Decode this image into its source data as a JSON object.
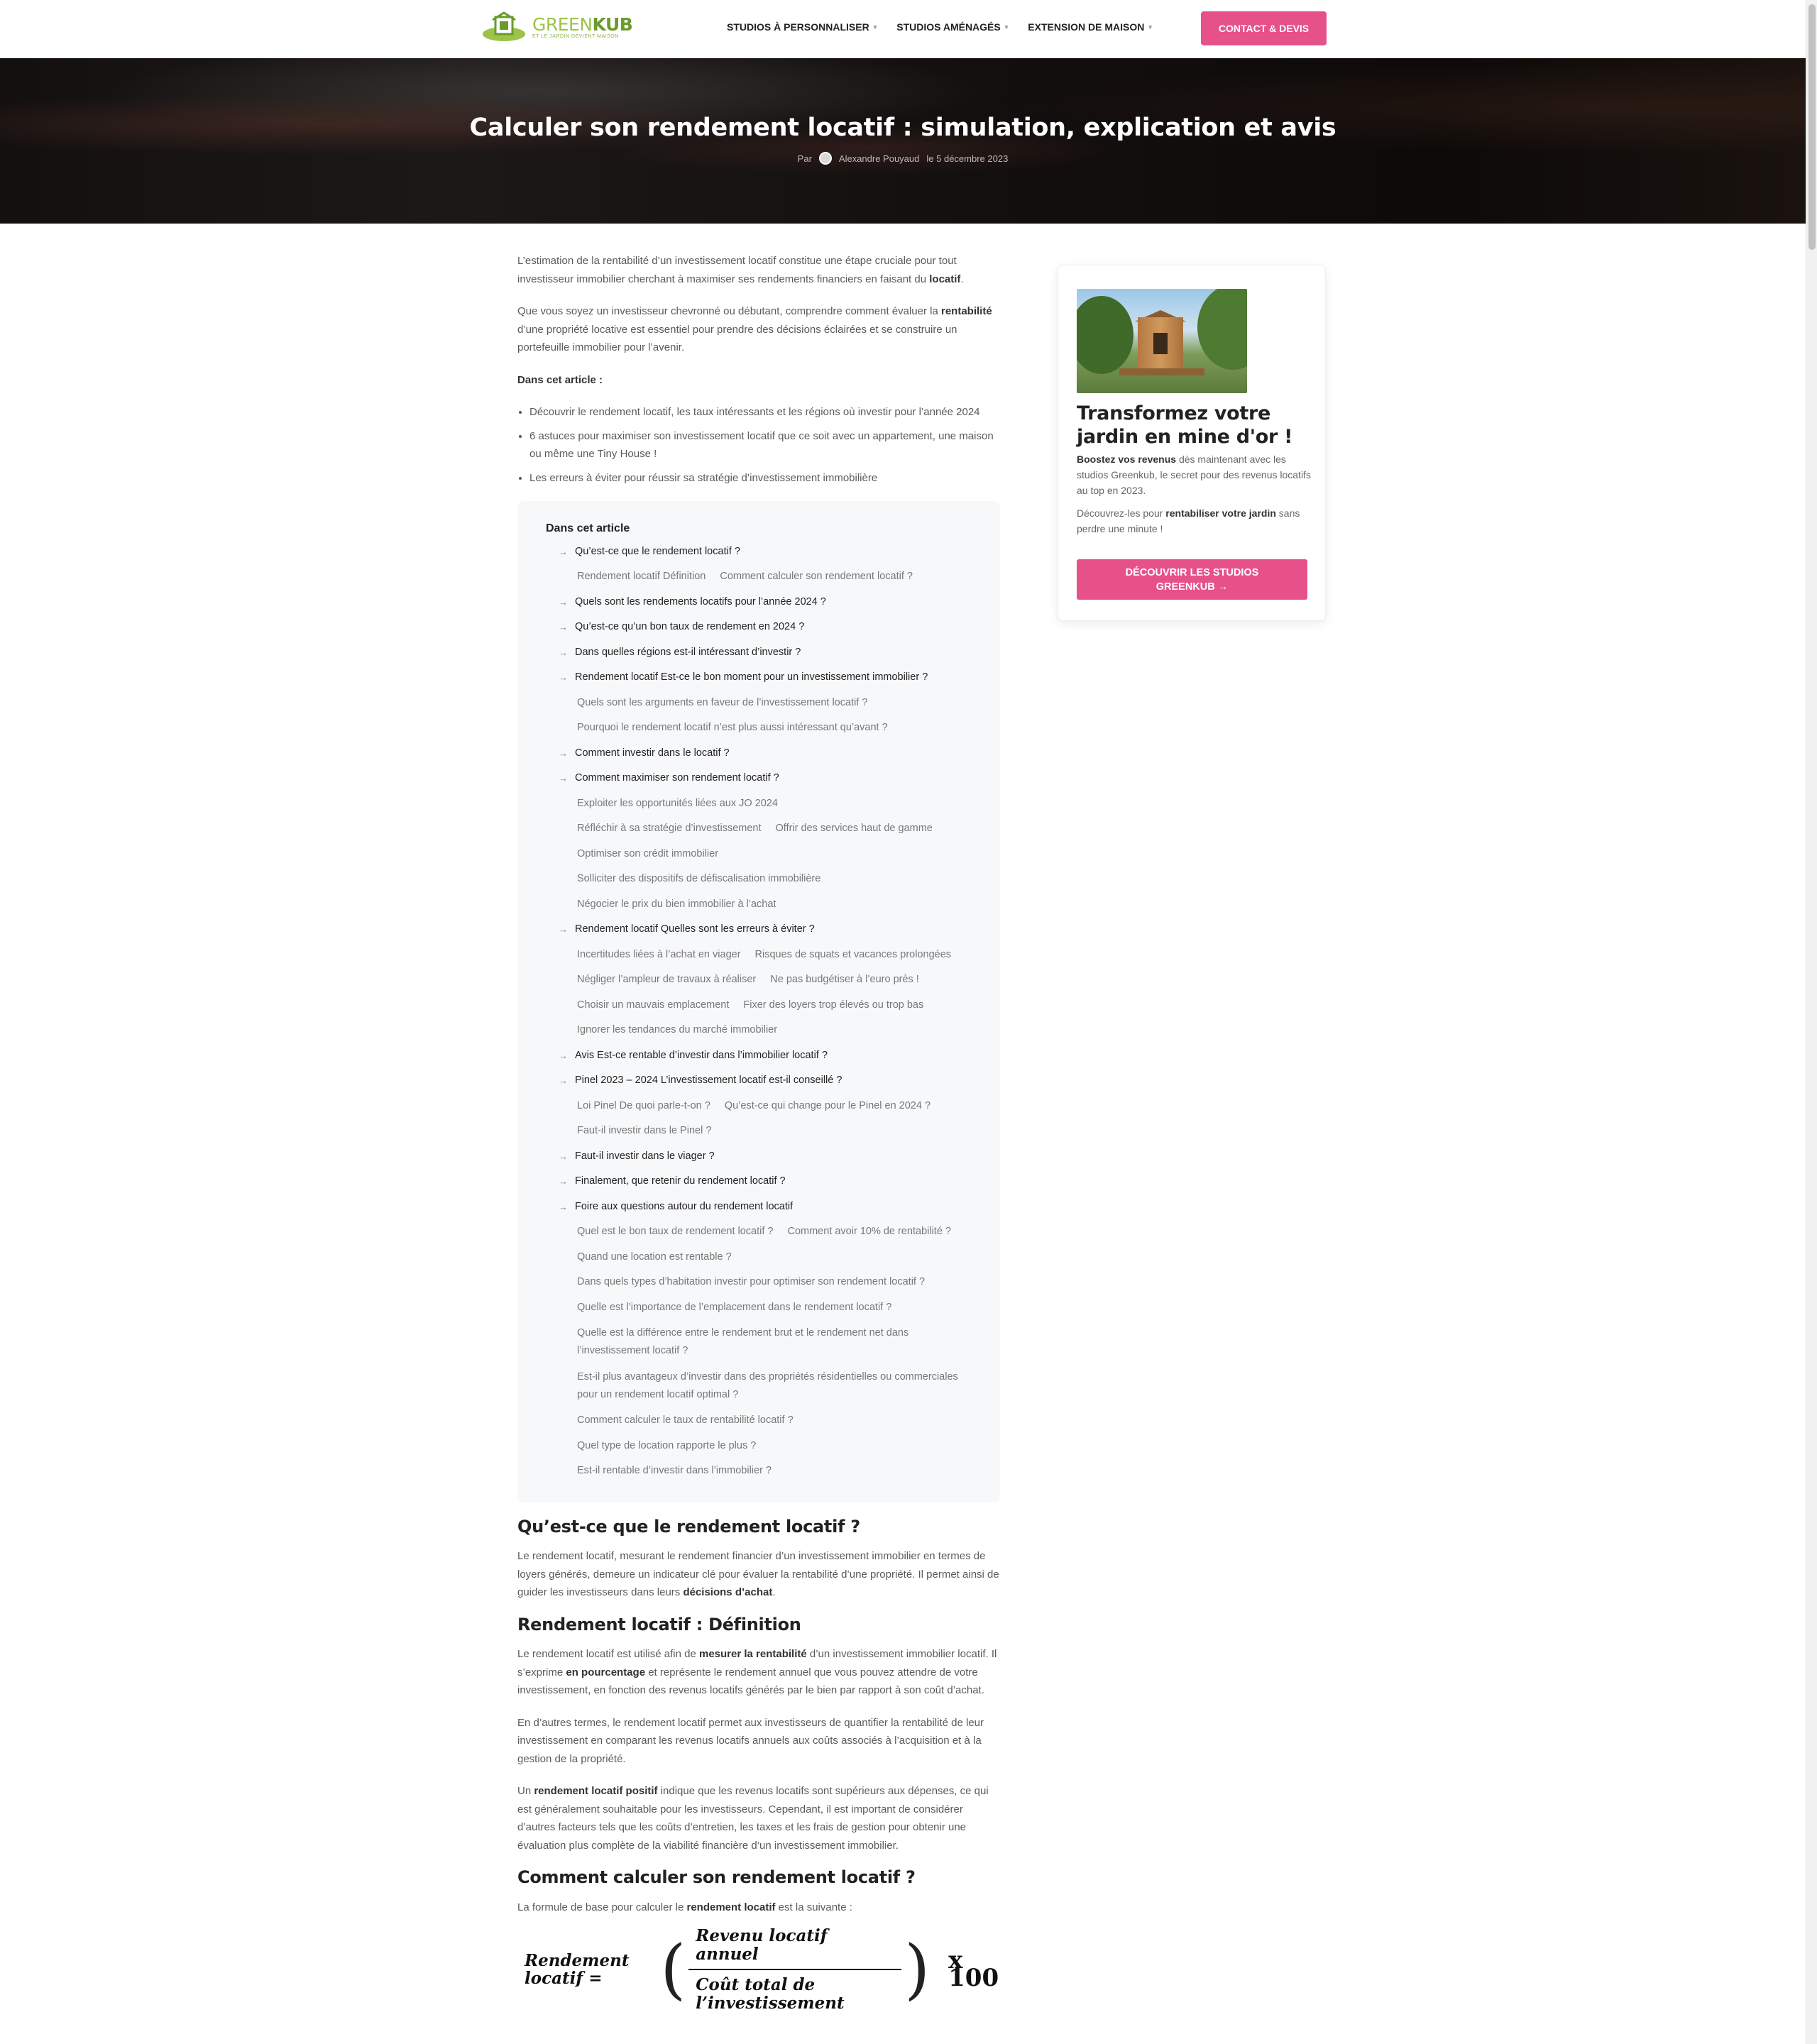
{
  "header": {
    "logo": {
      "name_part1": "GREEN",
      "name_part2": "KUB",
      "tagline": "ET LE JARDIN DEVIENT MAISON"
    },
    "nav": [
      {
        "label": "STUDIOS À PERSONNALISER"
      },
      {
        "label": "STUDIOS AMÉNAGÉS"
      },
      {
        "label": "EXTENSION DE MAISON"
      }
    ],
    "cta_label": "CONTACT & DEVIS"
  },
  "hero": {
    "title": "Calculer son rendement locatif : simulation, explication et avis",
    "by_label": "Par",
    "author": "Alexandre Pouyaud",
    "date": "le 5 décembre 2023"
  },
  "article": {
    "intro": [
      "L’estimation de la rentabilité d’un investissement locatif constitue une étape cruciale pour tout investisseur immobilier cherchant à maximiser ses rendements financiers en faisant du ",
      "locatif",
      ".",
      "Que vous soyez un investisseur chevronné ou débutant, comprendre comment évaluer la ",
      "rentabilité",
      " d’une propriété locative est essentiel pour prendre des décisions éclairées et se construire un portefeuille immobilier pour l’avenir."
    ],
    "in_article_label": "Dans cet article :",
    "intro_list": [
      "Découvrir le rendement locatif, les taux intéressants et les régions où investir pour l’année 2024",
      "6 astuces pour maximiser son investissement locatif que ce soit avec un appartement, une maison ou même une Tiny House !",
      "Les erreurs à éviter pour réussir sa stratégie d’investissement immobilière"
    ],
    "toc": {
      "title": "Dans cet article",
      "arrow": "→",
      "sections": [
        {
          "label": "Qu’est-ce que le rendement locatif ?",
          "subs": [
            [
              "Rendement locatif Définition",
              "Comment calculer son rendement locatif ?"
            ]
          ]
        },
        {
          "label": "Quels sont les rendements locatifs pour l’année 2024 ?",
          "subs": []
        },
        {
          "label": "Qu’est-ce qu’un bon taux de rendement en 2024 ?",
          "subs": []
        },
        {
          "label": "Dans quelles régions est-il intéressant d’investir ?",
          "subs": []
        },
        {
          "label": "Rendement locatif Est-ce le bon moment pour un investissement immobilier ?",
          "subs": [
            [
              "Quels sont les arguments en faveur de l’investissement locatif ?"
            ],
            [
              "Pourquoi le rendement locatif n’est plus aussi intéressant qu’avant ?"
            ]
          ]
        },
        {
          "label": "Comment investir dans le locatif ?",
          "subs": []
        },
        {
          "label": "Comment maximiser son rendement locatif ?",
          "subs": [
            [
              "Exploiter les opportunités liées aux JO 2024"
            ],
            [
              "Réfléchir à sa stratégie d’investissement",
              "Offrir des services haut de gamme"
            ],
            [
              "Optimiser son crédit immobilier"
            ],
            [
              "Solliciter des dispositifs de défiscalisation immobilière"
            ],
            [
              "Négocier le prix du bien immobilier à l’achat"
            ]
          ]
        },
        {
          "label": "Rendement locatif Quelles sont les erreurs à éviter ?",
          "subs": [
            [
              "Incertitudes liées à l’achat en viager",
              "Risques de squats et vacances prolongées"
            ],
            [
              "Négliger l’ampleur de travaux à réaliser",
              "Ne pas budgétiser à l’euro près !"
            ],
            [
              "Choisir un mauvais emplacement",
              "Fixer des loyers trop élevés ou trop bas"
            ],
            [
              "Ignorer les tendances du marché immobilier"
            ]
          ]
        },
        {
          "label": "Avis Est-ce rentable d’investir dans l’immobilier locatif ?",
          "subs": []
        },
        {
          "label": "Pinel 2023 – 2024 L’investissement locatif est-il conseillé ?",
          "subs": [
            [
              "Loi Pinel De quoi parle-t-on ?",
              "Qu’est-ce qui change pour le Pinel en 2024 ?"
            ],
            [
              "Faut-il investir dans le Pinel ?"
            ]
          ]
        },
        {
          "label": "Faut-il investir dans le viager ?",
          "subs": []
        },
        {
          "label": "Finalement, que retenir du rendement locatif ?",
          "subs": []
        },
        {
          "label": "Foire aux questions autour du rendement locatif",
          "subs": [
            [
              "Quel est le bon taux de rendement locatif ?",
              "Comment avoir 10% de rentabilité ?"
            ],
            [
              "Quand une location est rentable ?"
            ],
            [
              "Dans quels types d’habitation investir pour optimiser son rendement locatif ?"
            ],
            [
              "Quelle est l’importance de l’emplacement dans le rendement locatif ?"
            ],
            [
              "Quelle est la différence entre le rendement brut et le rendement net dans l’investissement locatif ?"
            ],
            [
              "Est-il plus avantageux d’investir dans des propriétés résidentielles ou commerciales pour un rendement locatif optimal ?"
            ],
            [
              "Comment calculer le taux de rentabilité locatif ?"
            ],
            [
              "Quel type de location rapporte le plus ?"
            ],
            [
              "Est-il rentable d’investir dans l’immobilier ?"
            ]
          ]
        }
      ]
    },
    "h2_what": "Qu’est-ce que le rendement locatif ?",
    "p_what": [
      "Le rendement locatif, mesurant le rendement financier d’un investissement immobilier en termes de loyers générés, demeure un indicateur clé pour évaluer la rentabilité d’une propriété. Il permet ainsi de guider les investisseurs dans leurs ",
      "décisions d’achat",
      "."
    ],
    "h2_def": "Rendement locatif : Définition",
    "p_def1": [
      "Le rendement locatif est utilisé afin de ",
      "mesurer la rentabilité",
      " d’un investissement immobilier locatif. Il s’exprime ",
      "en pourcentage",
      " et représente le rendement annuel que vous pouvez attendre de votre investissement, en fonction des revenus locatifs générés par le bien par rapport à son coût d’achat."
    ],
    "p_def2": "En d’autres termes, le rendement locatif permet aux investisseurs de quantifier la rentabilité de leur investissement en comparant les revenus locatifs annuels aux coûts associés à l’acquisition et à la gestion de la propriété.",
    "p_def3": [
      "Un ",
      "rendement locatif positif",
      " indique que les revenus locatifs sont supérieurs aux dépenses, ce qui est généralement souhaitable pour les investisseurs. Cependant, il est important de considérer d’autres facteurs tels que les coûts d’entretien, les taxes et les frais de gestion pour obtenir une évaluation plus complète de la viabilité financière d’un investissement immobilier."
    ],
    "h2_calc": "Comment calculer son rendement locatif ?",
    "p_calc": [
      "La formule de base pour calculer le ",
      "rendement locatif",
      " est la suivante :"
    ],
    "formula": {
      "label": "Rendement locatif =",
      "numerator": "Revenu locatif annuel",
      "denominator": "Coût total de l’investissement",
      "multiplier": "x 100"
    }
  },
  "sidebar": {
    "title": "Transformez votre jardin en mine d'or !",
    "p1_bold": "Boostez vos revenus",
    "p1_rest": " dès maintenant avec les studios Greenkub, le secret pour des revenus locatifs au top en 2023.",
    "p2_start": "Découvrez-les pour ",
    "p2_bold": "rentabiliser votre jardin",
    "p2_end": " sans perdre une minute !",
    "button_label": "DÉCOUVRIR LES STUDIOS GREENKUB →"
  },
  "colors": {
    "accent_pink": "#e6518a",
    "logo_green": "#9cc34a",
    "toc_bg": "#f7f8fa"
  }
}
